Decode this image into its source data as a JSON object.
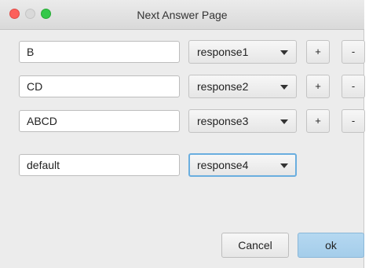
{
  "window": {
    "title": "Next Answer Page"
  },
  "rows": [
    {
      "text": "B",
      "response": "response1",
      "plus": "+",
      "minus": "-"
    },
    {
      "text": "CD",
      "response": "response2",
      "plus": "+",
      "minus": "-"
    },
    {
      "text": "ABCD",
      "response": "response3",
      "plus": "+",
      "minus": "-"
    }
  ],
  "default_row": {
    "text": "default",
    "response": "response4"
  },
  "buttons": {
    "cancel": "Cancel",
    "ok": "ok"
  },
  "colors": {
    "close": "#fc605b",
    "maximize": "#34c84a",
    "default_button": "#a4cdea",
    "focus_ring": "#6aaedf"
  }
}
